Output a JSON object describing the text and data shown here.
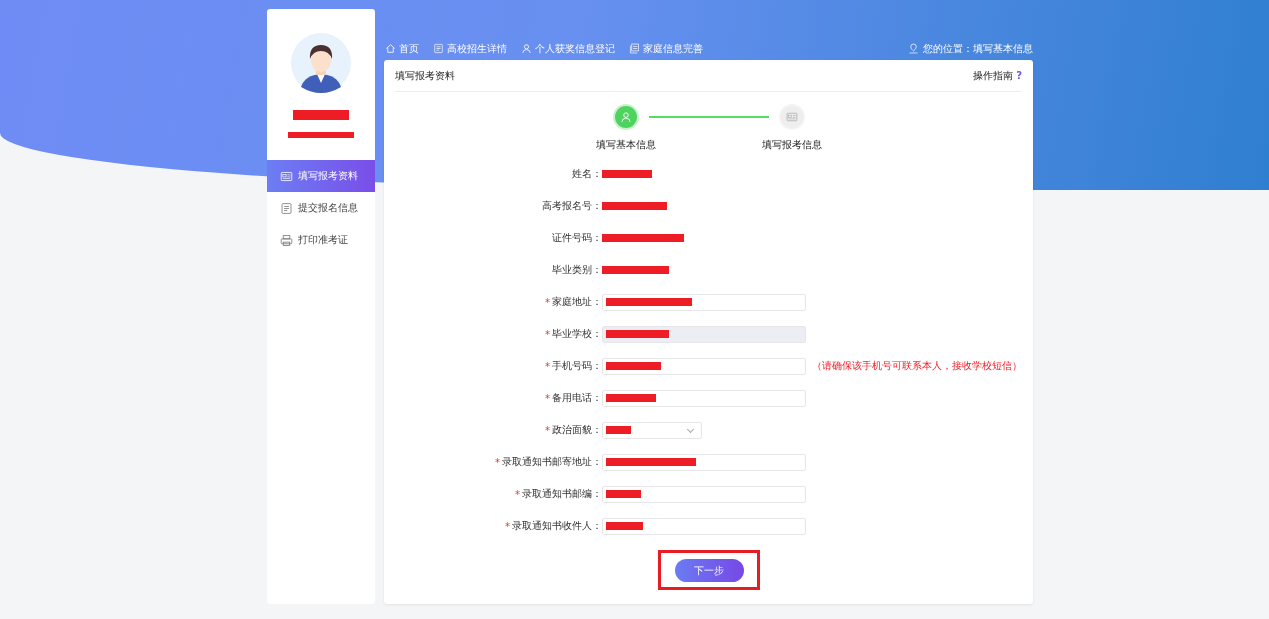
{
  "sidebar": {
    "items": [
      {
        "label": "填写报考资料",
        "selected": true
      },
      {
        "label": "提交报名信息",
        "selected": false
      },
      {
        "label": "打印准考证",
        "selected": false
      }
    ]
  },
  "nav": {
    "items": [
      {
        "label": "首页"
      },
      {
        "label": "高校招生详情"
      },
      {
        "label": "个人获奖信息登记"
      },
      {
        "label": "家庭信息完善"
      }
    ],
    "location": {
      "label": "您的位置：",
      "current": "填写基本信息"
    }
  },
  "card": {
    "title": "填写报考资料",
    "help": "操作指南",
    "help_mark": "?"
  },
  "steps": [
    {
      "label": "填写基本信息",
      "done": true
    },
    {
      "label": "填写报考信息",
      "done": false
    }
  ],
  "fields": [
    {
      "label": "姓名：",
      "kind": "display"
    },
    {
      "label": "高考报名号：",
      "kind": "display"
    },
    {
      "label": "证件号码：",
      "kind": "display"
    },
    {
      "label": "毕业类别：",
      "kind": "display"
    },
    {
      "label": "家庭地址：",
      "kind": "input",
      "required_mark": "*",
      "disabled": false
    },
    {
      "label": "毕业学校：",
      "kind": "input",
      "required_mark": "*",
      "disabled": true
    },
    {
      "label": "手机号码：",
      "kind": "input",
      "required_mark": "*",
      "disabled": false,
      "hint": "（请确保该手机号可联系本人，接收学校短信）"
    },
    {
      "label": "备用电话：",
      "kind": "input",
      "required_mark": "*",
      "disabled": false
    },
    {
      "label": "政治面貌：",
      "kind": "select",
      "required_mark": "*",
      "disabled": false
    },
    {
      "label": "录取通知书邮寄地址：",
      "kind": "input",
      "required_mark": "*",
      "disabled": false
    },
    {
      "label": "录取通知书邮编：",
      "kind": "input",
      "required_mark": "*",
      "disabled": false
    },
    {
      "label": "录取通知书收件人：",
      "kind": "input",
      "required_mark": "*",
      "disabled": false
    }
  ],
  "next_button": {
    "label": "下一步",
    "highlighted": true
  }
}
